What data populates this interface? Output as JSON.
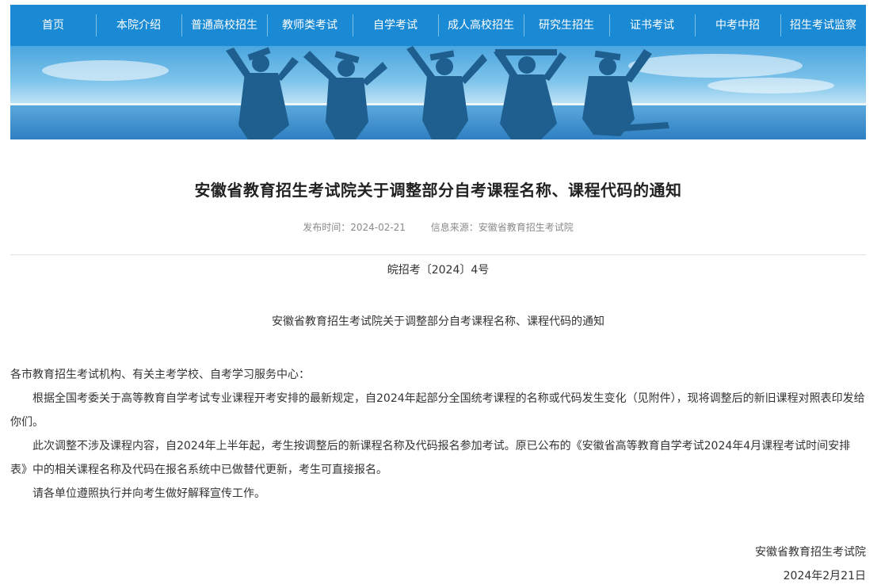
{
  "nav": {
    "items": [
      "首页",
      "本院介绍",
      "普通高校招生",
      "教师类考试",
      "自学考试",
      "成人高校招生",
      "研究生招生",
      "证书考试",
      "中考中招",
      "招生考试监察"
    ],
    "color": "#1a8ad4"
  },
  "article": {
    "title": "安徽省教育招生考试院关于调整部分自考课程名称、课程代码的通知",
    "publish_label": "发布时间：2024-02-21",
    "source_label": "信息来源：安徽省教育招生考试院",
    "doc_number": "皖招考〔2024〕4号",
    "subtitle": "安徽省教育招生考试院关于调整部分自考课程名称、课程代码的通知",
    "salutation": "各市教育招生考试机构、有关主考学校、自考学习服务中心：",
    "paragraphs": [
      "根据全国考委关于高等教育自学考试专业课程开考安排的最新规定，自2024年起部分全国统考课程的名称或代码发生变化（见附件），现将调整后的新旧课程对照表印发给你们。",
      "此次调整不涉及课程内容，自2024年上半年起，考生按调整后的新课程名称及代码报名参加考试。原已公布的《安徽省高等教育自学考试2024年4月课程考试时间安排表》中的相关课程名称及代码在报名系统中已做替代更新，考生可直接报名。",
      "请各单位遵照执行并向考生做好解释宣传工作。"
    ],
    "signature": "安徽省教育招生考试院",
    "date": "2024年2月21日"
  }
}
